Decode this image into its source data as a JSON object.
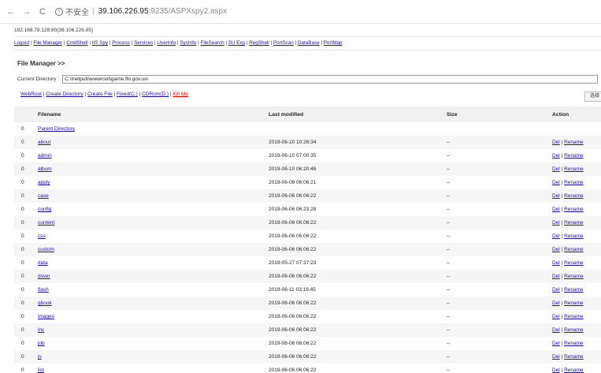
{
  "browser": {
    "back_icon": "back-arrow-icon",
    "forward_icon": "forward-arrow-icon",
    "reload_icon": "reload-icon",
    "security_label": "不安全",
    "separator": "|",
    "host": "39.106.226.95",
    "port_path": ":9235/ASPXspy2.aspx"
  },
  "header": {
    "ip_line": "192.168.79.128:80(39.106.226.95)",
    "menu": [
      "Logout",
      "File Manager",
      "CmdShell",
      "IIS Spy",
      "Process",
      "Services",
      "UserInfo",
      "SysInfo",
      "FileSearch",
      "SU Exp",
      "RegShell",
      "PortScan",
      "DataBase",
      "PortMap"
    ]
  },
  "file_manager": {
    "title": "File Manager >>",
    "current_directory_label": "Current Directory :",
    "current_directory_value": "C:\\Inetpub\\wwwroot\\game.fbi.gov.us\\",
    "links": [
      "WebRoot",
      "Create Directory",
      "Create File",
      "Fixed(C:)",
      "CDRom(D:)"
    ],
    "kill_label": "Kill Me",
    "side_button": "选择",
    "columns": {
      "num": "",
      "name": "Filename",
      "modified": "Last modified",
      "size": "Size",
      "action": "Action"
    },
    "parent": {
      "num": "0",
      "name": "Parent Directory"
    },
    "del_label": "Del",
    "rename_label": "Rename",
    "rows": [
      {
        "num": "0",
        "name": "about",
        "modified": "2019-06-10 10:26:34",
        "size": "--"
      },
      {
        "num": "0",
        "name": "admin",
        "modified": "2019-06-10 07:00:35",
        "size": "--"
      },
      {
        "num": "0",
        "name": "album",
        "modified": "2019-06-10 06:20:46",
        "size": "--"
      },
      {
        "num": "0",
        "name": "apply",
        "modified": "2019-06-06 06:06:21",
        "size": "--"
      },
      {
        "num": "0",
        "name": "case",
        "modified": "2019-06-06 06:06:22",
        "size": "--"
      },
      {
        "num": "0",
        "name": "config",
        "modified": "2019-06-06 06:23:28",
        "size": "--"
      },
      {
        "num": "0",
        "name": "content",
        "modified": "2019-06-06 06:06:22",
        "size": "--"
      },
      {
        "num": "0",
        "name": "css",
        "modified": "2019-06-06 06:06:22",
        "size": "--"
      },
      {
        "num": "0",
        "name": "custom",
        "modified": "2019-06-06 06:06:22",
        "size": "--"
      },
      {
        "num": "0",
        "name": "data",
        "modified": "2019-05-27 07:37:23",
        "size": "--"
      },
      {
        "num": "0",
        "name": "down",
        "modified": "2019-06-06 06:06:22",
        "size": "--"
      },
      {
        "num": "0",
        "name": "flash",
        "modified": "2019-06-11 03:16:45",
        "size": "--"
      },
      {
        "num": "0",
        "name": "gbook",
        "modified": "2019-06-06 06:06:22",
        "size": "--"
      },
      {
        "num": "0",
        "name": "images",
        "modified": "2019-06-06 06:06:22",
        "size": "--"
      },
      {
        "num": "0",
        "name": "inc",
        "modified": "2019-06-06 06:06:22",
        "size": "--"
      },
      {
        "num": "0",
        "name": "job",
        "modified": "2019-06-06 06:06:22",
        "size": "--"
      },
      {
        "num": "0",
        "name": "js",
        "modified": "2019-06-06 06:06:22",
        "size": "--"
      },
      {
        "num": "0",
        "name": "list",
        "modified": "2019-06-06 06:06:22",
        "size": "--"
      }
    ]
  }
}
